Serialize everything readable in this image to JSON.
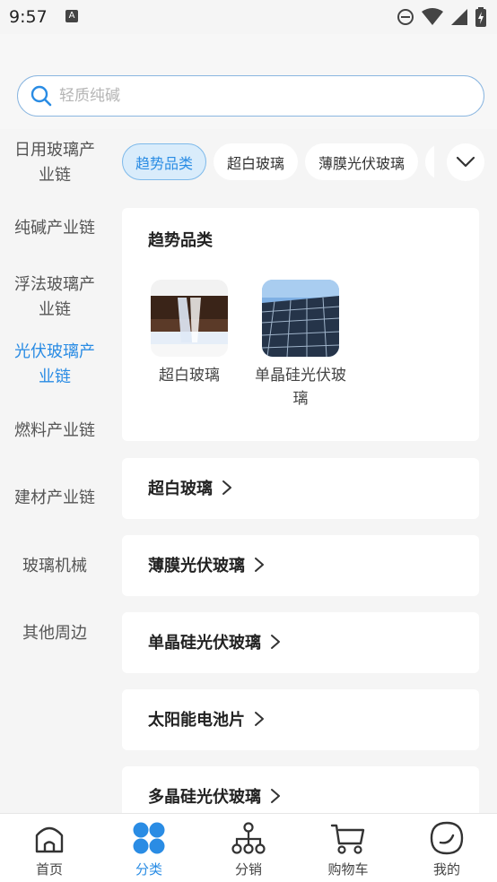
{
  "status_bar": {
    "time": "9:57"
  },
  "search": {
    "placeholder": "轻质纯碱"
  },
  "sidebar": {
    "items": [
      {
        "label": "日用玻璃产业链"
      },
      {
        "label": "纯碱产业链"
      },
      {
        "label": "浮法玻璃产业链"
      },
      {
        "label": "光伏玻璃产业链"
      },
      {
        "label": "燃料产业链"
      },
      {
        "label": "建材产业链"
      },
      {
        "label": "玻璃机械"
      },
      {
        "label": "其他周边"
      }
    ]
  },
  "chips": [
    {
      "label": "趋势品类"
    },
    {
      "label": "超白玻璃"
    },
    {
      "label": "薄膜光伏玻璃"
    }
  ],
  "trend_card": {
    "title": "趋势品类",
    "items": [
      {
        "label": "超白玻璃"
      },
      {
        "label": "单晶硅光伏玻璃"
      }
    ]
  },
  "categories": [
    {
      "label": "超白玻璃"
    },
    {
      "label": "薄膜光伏玻璃"
    },
    {
      "label": "单晶硅光伏玻璃"
    },
    {
      "label": "太阳能电池片"
    },
    {
      "label": "多晶硅光伏玻璃"
    }
  ],
  "tabbar": {
    "items": [
      {
        "label": "首页"
      },
      {
        "label": "分类"
      },
      {
        "label": "分销"
      },
      {
        "label": "购物车"
      },
      {
        "label": "我的"
      }
    ]
  },
  "colors": {
    "accent": "#2a8ce4",
    "active_chip_bg": "#d9ecfb"
  }
}
